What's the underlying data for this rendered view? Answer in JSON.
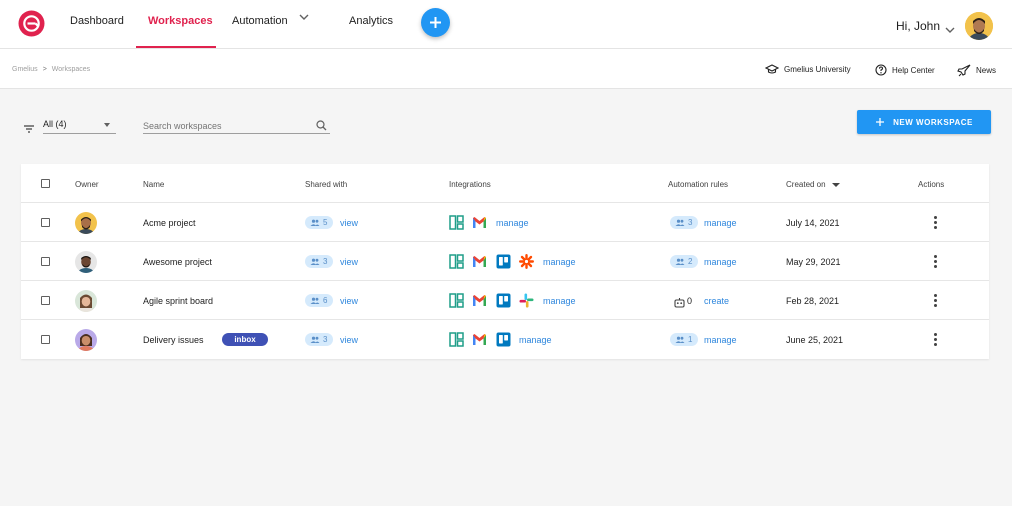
{
  "nav": {
    "items": [
      "Dashboard",
      "Workspaces",
      "Automation",
      "Analytics"
    ],
    "greeting": "Hi, John",
    "brand_color": "#e0224e",
    "accent_color": "#2196f3"
  },
  "breadcrumb": [
    "Gmelius",
    "Workspaces"
  ],
  "sublinks": [
    "Gmelius University",
    "Help Center",
    "News"
  ],
  "toolbar": {
    "filter_value": "All (4)",
    "search_placeholder": "Search workspaces",
    "new_button": "NEW WORKSPACE"
  },
  "table": {
    "columns": [
      "Owner",
      "Name",
      "Shared with",
      "Integrations",
      "Automation rules",
      "Created on",
      "Actions"
    ],
    "rows": [
      {
        "name": "Acme project",
        "badge": "",
        "shared": "5",
        "shared_link": "view",
        "integrations": [
          "workspace-board",
          "gmail"
        ],
        "integrations_link": "manage",
        "rules": "3",
        "rules_link": "manage",
        "created": "July 14, 2021"
      },
      {
        "name": "Awesome project",
        "badge": "",
        "shared": "3",
        "shared_link": "view",
        "integrations": [
          "workspace-board",
          "gmail",
          "trello",
          "zapier"
        ],
        "integrations_link": "manage",
        "rules": "2",
        "rules_link": "manage",
        "created": "May 29, 2021"
      },
      {
        "name": "Agile sprint board",
        "badge": "",
        "shared": "6",
        "shared_link": "view",
        "integrations": [
          "workspace-board",
          "gmail",
          "trello",
          "slack"
        ],
        "integrations_link": "manage",
        "rules": "0",
        "rules_link": "create",
        "created": "Feb 28, 2021"
      },
      {
        "name": "Delivery issues",
        "badge": "inbox",
        "shared": "3",
        "shared_link": "view",
        "integrations": [
          "workspace-board",
          "gmail",
          "trello"
        ],
        "integrations_link": "manage",
        "rules": "1",
        "rules_link": "manage",
        "created": "June 25, 2021"
      }
    ]
  }
}
